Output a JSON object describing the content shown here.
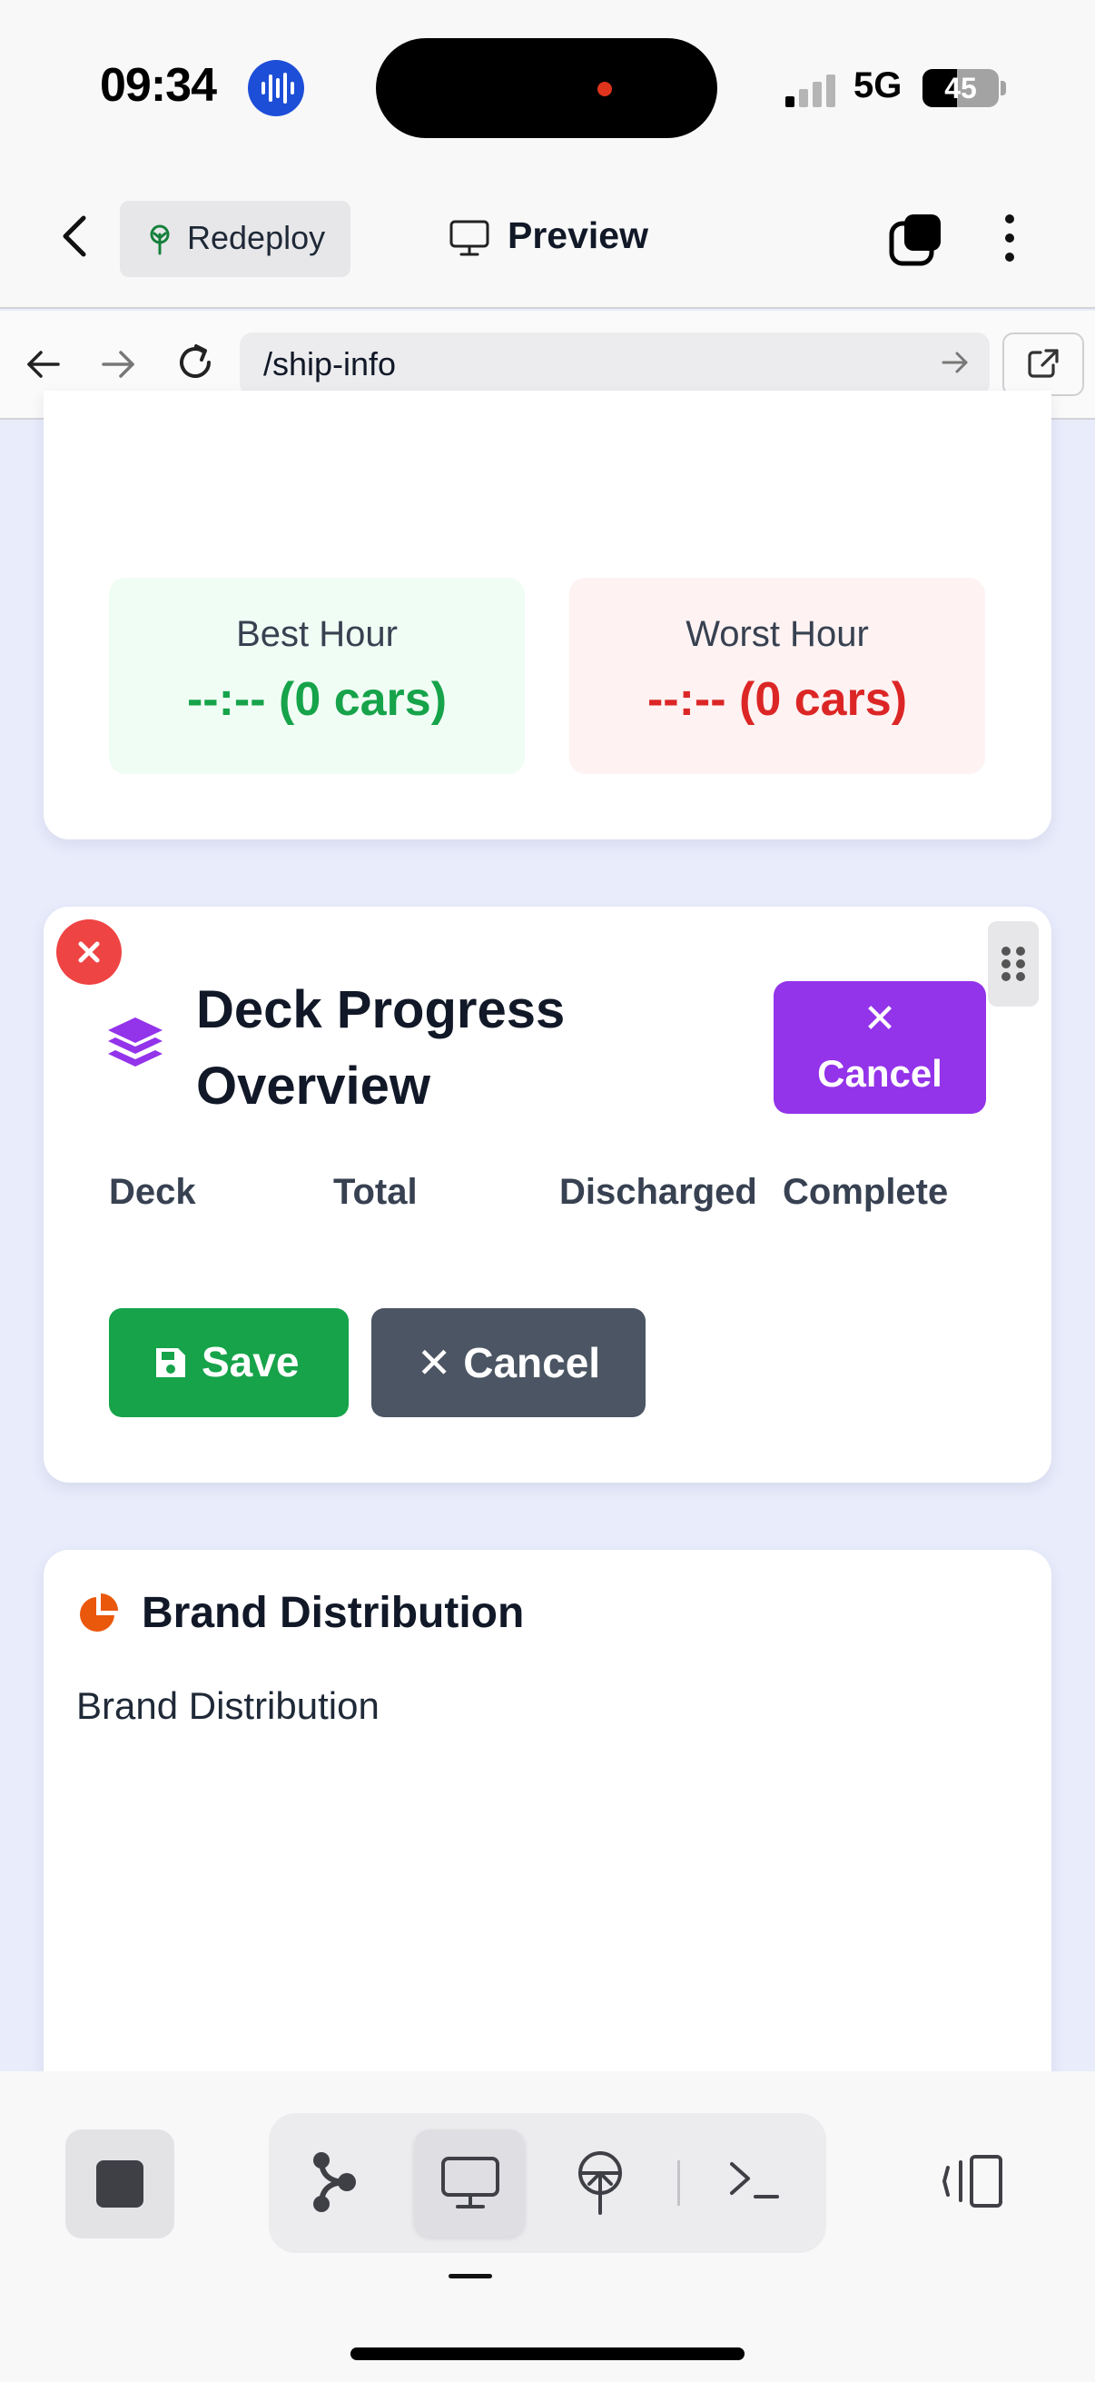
{
  "status_bar": {
    "time": "09:34",
    "network": "5G",
    "battery_percent": 45,
    "battery_label": "45"
  },
  "header": {
    "redeploy_label": "Redeploy",
    "preview_label": "Preview"
  },
  "browser": {
    "url": "/ship-info"
  },
  "hour_stats": {
    "best": {
      "label": "Best Hour",
      "value": "--:-- (0 cars)"
    },
    "worst": {
      "label": "Worst Hour",
      "value": "--:-- (0 cars)"
    }
  },
  "deck_progress": {
    "title": "Deck Progress Overview",
    "cancel_x": "✕",
    "cancel_label": "Cancel",
    "columns": [
      "Deck",
      "Total",
      "Discharged",
      "Complete"
    ],
    "save_label": "Save",
    "cancel_edit_label": "✕ Cancel"
  },
  "brand_distribution": {
    "title": "Brand Distribution",
    "subtitle": "Brand Distribution"
  },
  "colors": {
    "accent_purple": "#9333ea",
    "save_green": "#16a34a",
    "best_green": "#16a34a",
    "worst_red": "#dc2626",
    "remove_red": "#ef4444",
    "cancel_gray": "#4b5563"
  },
  "icons": {
    "back": "chevron-left-icon",
    "redeploy": "tree-icon",
    "preview": "monitor-icon",
    "tabs": "tabs-icon",
    "more": "more-vertical-icon",
    "layers": "layers-icon",
    "save": "floppy-disk-icon",
    "pie": "pie-chart-icon",
    "graph": "graph-icon",
    "deploy": "deploy-icon",
    "terminal": "terminal-icon",
    "sidebar": "sidebar-toggle-icon"
  }
}
